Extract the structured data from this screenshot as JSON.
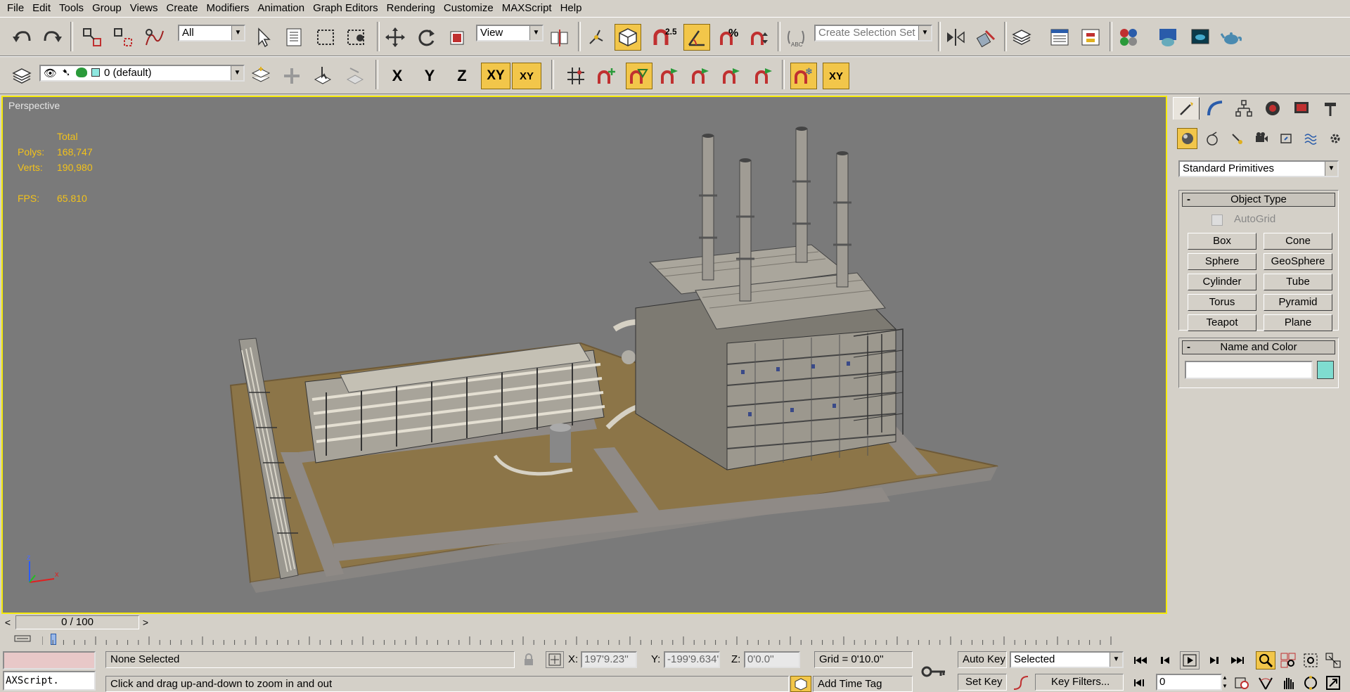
{
  "menu": [
    "File",
    "Edit",
    "Tools",
    "Group",
    "Views",
    "Create",
    "Modifiers",
    "Animation",
    "Graph Editors",
    "Rendering",
    "Customize",
    "MAXScript",
    "Help"
  ],
  "toolbar": {
    "filter_value": "All",
    "refcoord_value": "View",
    "snap_label": "2.5",
    "percent_snap_label": "%",
    "named_selection_placeholder": "Create Selection Set"
  },
  "layer_toolbar": {
    "layer_value": "0 (default)",
    "axis_x": "X",
    "axis_y": "Y",
    "axis_z": "Z",
    "axis_xy": "XY",
    "axis_xy2": "XY",
    "snap_xy": "XY"
  },
  "viewport": {
    "label": "Perspective",
    "stats_header": "Total",
    "polys_label": "Polys:",
    "polys_value": "168,747",
    "verts_label": "Verts:",
    "verts_value": "190,980",
    "fps_label": "FPS:",
    "fps_value": "65.810",
    "axis_labels": {
      "z": "z",
      "x": "x"
    }
  },
  "command_panel": {
    "category_value": "Standard Primitives",
    "object_type_title": "Object Type",
    "autogrid_label": "AutoGrid",
    "primitives": [
      "Box",
      "Cone",
      "Sphere",
      "GeoSphere",
      "Cylinder",
      "Tube",
      "Torus",
      "Pyramid",
      "Teapot",
      "Plane"
    ],
    "name_color_title": "Name and Color",
    "name_value": "",
    "object_color": "#7fdcd0"
  },
  "timeline": {
    "slider_label": "0 / 100",
    "prev_arrow": "<",
    "next_arrow": ">"
  },
  "status": {
    "maxscript_label": "AXScript.",
    "selection_text": "None Selected",
    "prompt_text": "Click and drag up-and-down to zoom in and out",
    "x_label": "X:",
    "x_value": "197'9.23''",
    "y_label": "Y:",
    "y_value": "-199'9.634'",
    "z_label": "Z:",
    "z_value": "0'0.0''",
    "grid_text": "Grid = 0'10.0''",
    "add_time_tag": "Add Time Tag",
    "auto_key": "Auto Key",
    "set_key": "Set Key",
    "key_mode_value": "Selected",
    "key_filters": "Key Filters...",
    "frame_value": "0"
  },
  "colors": {
    "accent": "#f2c64a",
    "viewport_border": "#f5e90a",
    "stats_text": "#f3c21a",
    "viewport_bg": "#7a7a7a"
  }
}
